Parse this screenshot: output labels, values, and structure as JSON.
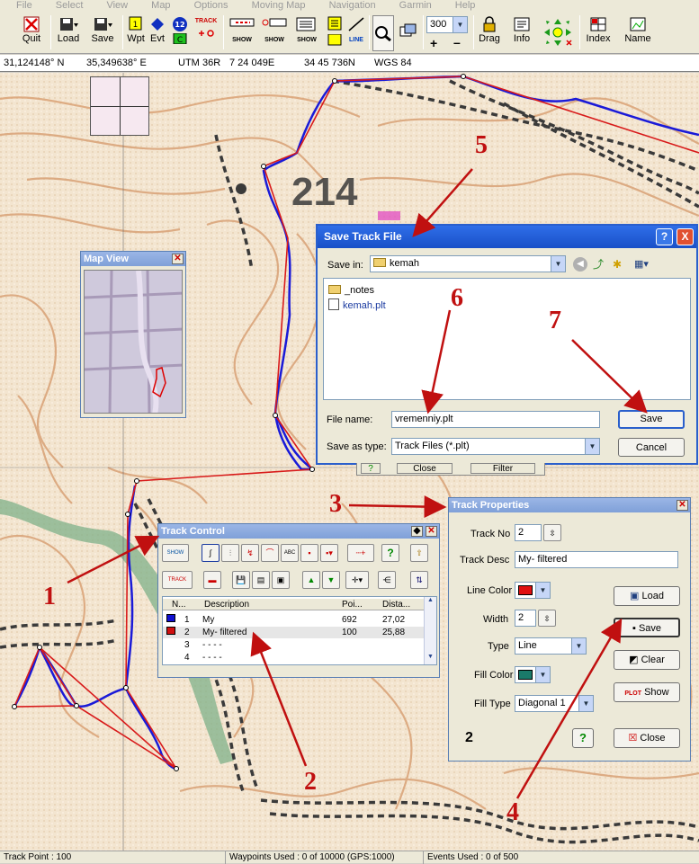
{
  "menu": [
    "File",
    "Select",
    "View",
    "Map",
    "Options",
    "Moving Map",
    "Navigation",
    "Garmin",
    "Help"
  ],
  "toolbar": {
    "quit": "Quit",
    "load": "Load",
    "save": "Save",
    "wpt": "Wpt",
    "evt": "Evt",
    "track": "TRACK",
    "show": "SHOW",
    "line": "LINE",
    "zoom_value": "300",
    "drag": "Drag",
    "info": "Info",
    "index": "Index",
    "name": "Name",
    "icon_wpt_num": "1",
    "icon_event_num": "12",
    "icon_c": "C",
    "icon_minus": "–",
    "icon_plus": "+"
  },
  "coords": {
    "lat": "31,124148° N",
    "lon": "35,349638° E",
    "utm_label": "UTM",
    "zone": "36R",
    "easting": "7 24 049E",
    "northing": "34 45 736N",
    "datum": "WGS 84"
  },
  "map": {
    "label": "214"
  },
  "map_view": {
    "title": "Map View"
  },
  "save_dialog": {
    "title": "Save Track File",
    "help": "?",
    "close": "X",
    "save_in_label": "Save in:",
    "save_in_value": "kemah",
    "files": [
      "_notes",
      "kemah.plt"
    ],
    "file_name_label": "File name:",
    "file_name_value": "vremenniy.plt",
    "save_as_type_label": "Save as type:",
    "save_as_type_value": "Track Files (*.plt)",
    "save_button": "Save",
    "cancel_button": "Cancel"
  },
  "behind_dialog": {
    "help": "?",
    "close": "Close",
    "filter": "Filter"
  },
  "track_control": {
    "title": "Track Control",
    "icon_show": "SHOW",
    "icon_abc": "ABC",
    "icon_track": "TRACK",
    "icon_help": "?",
    "headers": [
      "N...",
      "Description",
      "Poi...",
      "Dista..."
    ],
    "rows": [
      {
        "n": "1",
        "desc": "My",
        "points": "692",
        "dist": "27,02",
        "color": "#1010d0"
      },
      {
        "n": "2",
        "desc": "My- filtered",
        "points": "100",
        "dist": "25,88",
        "color": "#d01010"
      },
      {
        "n": "3",
        "desc": "- - - -",
        "points": "",
        "dist": "",
        "color": ""
      },
      {
        "n": "4",
        "desc": "- - - -",
        "points": "",
        "dist": "",
        "color": ""
      }
    ]
  },
  "track_props": {
    "title": "Track Properties",
    "track_no_label": "Track No",
    "track_no_value": "2",
    "track_desc_label": "Track Desc",
    "track_desc_value": "My- filtered",
    "line_color_label": "Line Color",
    "line_color": "#e01010",
    "width_label": "Width",
    "width_value": "2",
    "type_label": "Type",
    "type_value": "Line",
    "fill_color_label": "Fill Color",
    "fill_color": "#1a7a6a",
    "fill_type_label": "Fill Type",
    "fill_type_value": "Diagonal 1",
    "load_button": "Load",
    "save_button": "Save",
    "clear_button": "Clear",
    "show_button": "Show",
    "plot_label": "PLOT",
    "close_button": "Close",
    "help_button": "?",
    "footer_number": "2"
  },
  "annotations": [
    "1",
    "2",
    "3",
    "4",
    "5",
    "6",
    "7"
  ],
  "status": {
    "track_point": "Track Point : 100",
    "waypoints": "Waypoints Used : 0 of 10000  (GPS:1000)",
    "events": "Events Used : 0 of 500"
  },
  "colors": {
    "track_blue": "#1a1ad8",
    "track_red": "#d81a1a",
    "annotation_red": "#c01010",
    "xp_blue": "#2a5fcc"
  }
}
